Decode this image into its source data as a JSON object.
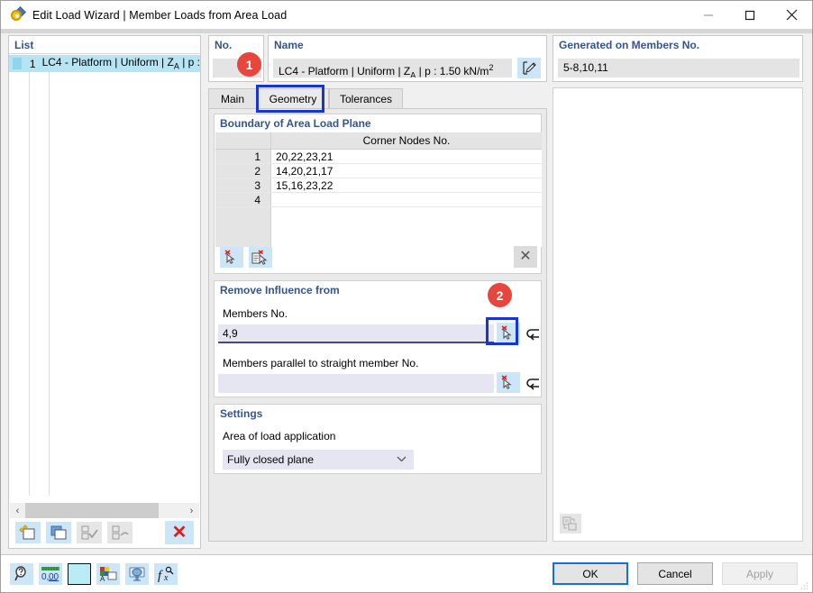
{
  "window": {
    "title": "Edit Load Wizard | Member Loads from Area Load",
    "icon": "load-wizard-icon",
    "minimize_label": "—",
    "maximize_label": "□",
    "close_label": "✕"
  },
  "list_panel": {
    "header": "List",
    "rows": [
      {
        "number": "1",
        "text_before": "LC4 - Platform | Uniform | Z",
        "sub": "A",
        "text_after": " | p :",
        "swatch_color": "#8fd6ec",
        "selected": true
      }
    ],
    "scrollbar": {
      "left_arrow": "‹",
      "right_arrow": "›"
    },
    "toolbar": [
      {
        "name": "new-item-button",
        "label": "",
        "enabled": true
      },
      {
        "name": "copy-item-button",
        "label": "",
        "enabled": true
      },
      {
        "name": "select-all-button",
        "label": "",
        "enabled": false
      },
      {
        "name": "invert-selection-button",
        "label": "",
        "enabled": false
      },
      {
        "name": "delete-item-button",
        "label": "✕",
        "enabled": true
      }
    ]
  },
  "no_box": {
    "label": "No.",
    "value": ""
  },
  "name_box": {
    "label": "Name",
    "value_before": "LC4 - Platform | Uniform | Z",
    "sub": "A",
    "value_mid": " | p : 1.50 kN/m",
    "sup": "2",
    "edit_button": "edit-name-button"
  },
  "generated_box": {
    "label": "Generated on Members No.",
    "value": "5-8,10,11"
  },
  "badges": [
    {
      "id": "1",
      "label": "1"
    },
    {
      "id": "2",
      "label": "2"
    }
  ],
  "tabs": [
    {
      "id": "main",
      "label": "Main",
      "active": false
    },
    {
      "id": "geometry",
      "label": "Geometry",
      "active": true
    },
    {
      "id": "tolerances",
      "label": "Tolerances",
      "active": false
    }
  ],
  "boundary_section": {
    "title": "Boundary of Area Load Plane",
    "column_header": "Corner Nodes No.",
    "rows": [
      {
        "index": "1",
        "nodes": "20,22,23,21"
      },
      {
        "index": "2",
        "nodes": "14,20,21,17"
      },
      {
        "index": "3",
        "nodes": "15,16,23,22"
      },
      {
        "index": "4",
        "nodes": ""
      }
    ],
    "pick_button": "pick-nodes-button",
    "pick_from_list_button": "pick-nodes-from-list-button",
    "clear_button": "✕"
  },
  "remove_section": {
    "title": "Remove Influence from",
    "members_label": "Members No.",
    "members_value": "4,9",
    "members_pick_button": "pick-members-button",
    "members_return_button": "↺",
    "parallel_label": "Members parallel to straight member No.",
    "parallel_value": "",
    "parallel_pick_button": "pick-parallel-members-button",
    "parallel_return_button": "↺"
  },
  "settings_section": {
    "title": "Settings",
    "area_label": "Area of load application",
    "area_value": "Fully closed plane",
    "chevron": "⌄"
  },
  "preview": {
    "export_button": "export-preview-button"
  },
  "status_icons": [
    {
      "name": "help-magnifier-icon",
      "label": ""
    },
    {
      "name": "decimal-places-icon",
      "label": "0,00"
    },
    {
      "name": "color-swatch-icon",
      "label": ""
    },
    {
      "name": "color-layer-icon",
      "label": ""
    },
    {
      "name": "display-properties-icon",
      "label": ""
    },
    {
      "name": "function-editor-icon",
      "label": ""
    }
  ],
  "dialog_buttons": {
    "ok": "OK",
    "cancel": "Cancel",
    "apply": "Apply"
  },
  "colors": {
    "accent_blue": "#35548c",
    "badge_red": "#e8453c",
    "highlight_blue": "#1835cc",
    "focus_blue": "#1472d6",
    "selection_blue": "#b5e5f5"
  }
}
